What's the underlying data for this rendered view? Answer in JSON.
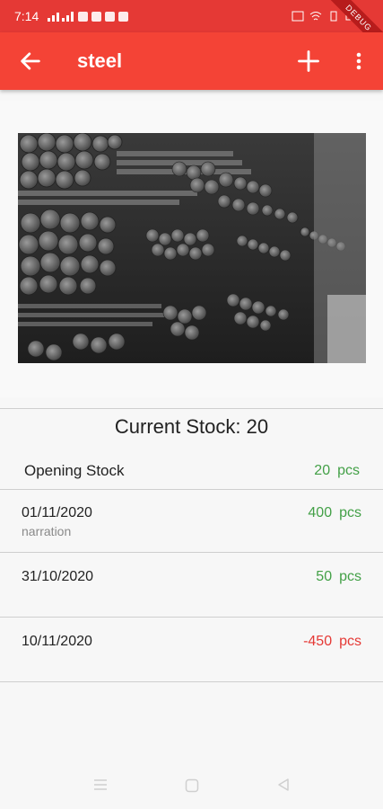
{
  "status": {
    "time": "7:14",
    "debug_label": "DEBUG"
  },
  "appbar": {
    "title": "steel",
    "back_icon": "arrow-left-icon",
    "add_icon": "plus-icon",
    "menu_icon": "more-vert-icon"
  },
  "colors": {
    "accent": "#f44336",
    "positive": "#43a047",
    "negative": "#e53935"
  },
  "current_stock_text": "Current Stock: 20",
  "opening": {
    "label": "Opening Stock",
    "qty": "20",
    "unit": "pcs"
  },
  "entries": [
    {
      "date": "01/11/2020",
      "narration": "narration",
      "qty": "400",
      "unit": "pcs",
      "negative": false
    },
    {
      "date": "31/10/2020",
      "narration": "",
      "qty": "50",
      "unit": "pcs",
      "negative": false
    },
    {
      "date": "10/11/2020",
      "narration": "",
      "qty": "-450",
      "unit": "pcs",
      "negative": true
    }
  ]
}
